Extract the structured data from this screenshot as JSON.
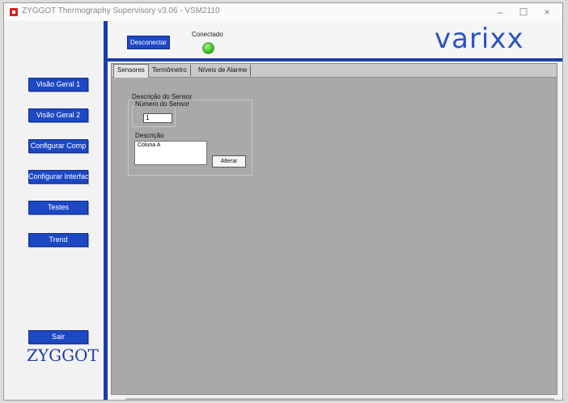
{
  "window": {
    "title": "ZYGGOT Thermography Supervisory v3.06 - VSM2110",
    "controls": {
      "minimize": "–",
      "maximize": "☐",
      "close": "×"
    }
  },
  "colors": {
    "accent": "#1d48c4",
    "divider": "#1c3ea8",
    "brand": "#2b53c4",
    "panel": "#a9a9a9",
    "led_on": "#2fbf18"
  },
  "sidebar": {
    "buttons": [
      {
        "label": "Visão Geral 1"
      },
      {
        "label": "Visão Geral 2"
      },
      {
        "label": "Configurar Comp"
      },
      {
        "label": "Configurar Interface"
      },
      {
        "label": "Testes"
      },
      {
        "label": "Trend"
      },
      {
        "label": "Sair"
      }
    ],
    "logo": "ZYGGOT"
  },
  "header": {
    "disconnect_label": "Desconectar",
    "status_label": "Conectado",
    "status_icon": "status-led-green",
    "brand": "varixx"
  },
  "tabs": [
    {
      "label": "Sensores",
      "active": true
    },
    {
      "label": "Termômetro",
      "active": false
    },
    {
      "label": "Níveis de Alarme",
      "active": false
    }
  ],
  "sensor_panel": {
    "group_title": "Descrição do Sensor",
    "number_label": "Número do Sensor",
    "number_value": "1",
    "description_label": "Descrição",
    "description_value": "Coluna A",
    "update_button": "Alterar"
  }
}
